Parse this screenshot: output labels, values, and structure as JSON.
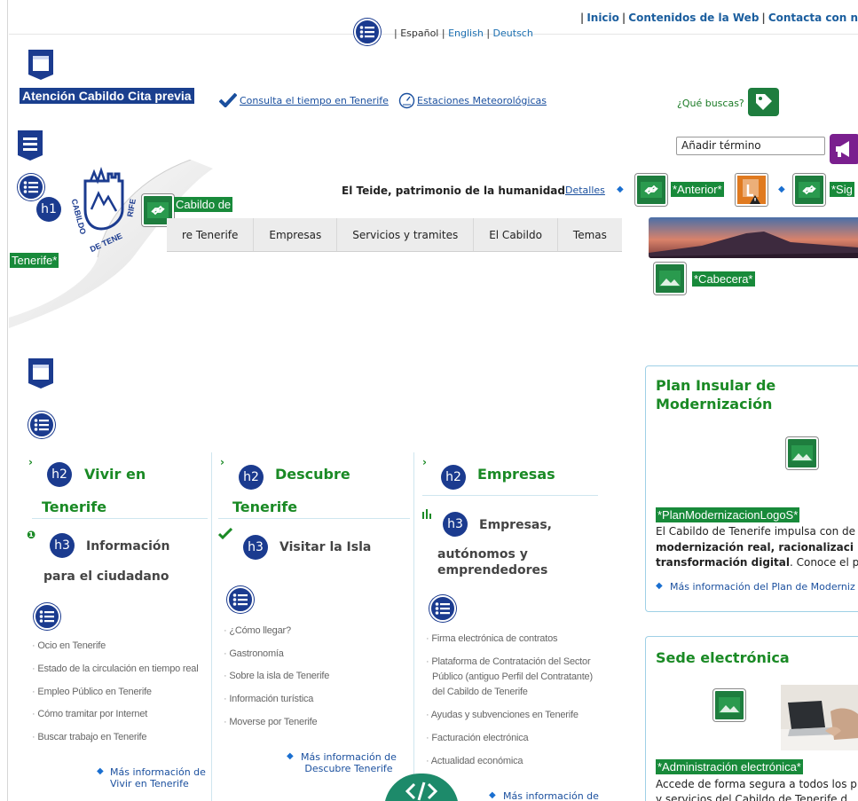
{
  "header": {
    "lang_current": "| Español",
    "lang_sep1": "|",
    "lang_en": "English",
    "lang_sep2": "|",
    "lang_de": "Deutsch",
    "top_inicio": "Inicio",
    "top_contenidos": "Contenidos de la Web",
    "top_contacta": "Contacta con n",
    "cita_button": "Atención Cabildo Cita previa",
    "weather_link": "Consulta el tiempo en Tenerife",
    "stations_link": "Estaciones Meteorológicas",
    "search_label": "¿Qué buscas?",
    "search_value": "Añadir término",
    "logo_alt_prefix": "Cabildo de",
    "logo_alt_suffix": "Tenerife*",
    "logo_text": "CABILDO DE TENERIFE"
  },
  "carousel": {
    "caption": "El Teide, patrimonio de la humanidad",
    "details_link": "Detalles",
    "prev_label": "*Anterior*",
    "next_label": "*Sig",
    "header_image_label": "*Cabecera*"
  },
  "nav": {
    "items": [
      "re Tenerife",
      "Empresas",
      "Servicios y tramites",
      "El Cabildo",
      "Temas"
    ]
  },
  "columns": {
    "vivir": {
      "h2_line1": "Vivir en",
      "h2_line2": "Tenerife",
      "h3_line1": "Información",
      "h3_line2": "para el ciudadano",
      "items": [
        "Ocio en Tenerife",
        "Estado de la circulación en tiempo real",
        "Empleo Público en Tenerife",
        "Cómo tramitar por Internet",
        "Buscar trabajo en Tenerife"
      ],
      "more_line1": "Más información de",
      "more_line2": "Vivir en Tenerife"
    },
    "descubre": {
      "h2_line1": "Descubre",
      "h2_line2": "Tenerife",
      "h3": "Visitar la Isla",
      "items": [
        "¿Cómo llegar?",
        "Gastronomía",
        "Sobre la isla de Tenerife",
        "Información turística",
        "Moverse por Tenerife"
      ],
      "more_line1": "Más información de",
      "more_line2": "Descubre Tenerife"
    },
    "empresas": {
      "h2": "Empresas",
      "h3_line1": "Empresas,",
      "h3_line2": "autónomos y",
      "h3_line3": "emprendedores",
      "items": [
        "Firma electrónica de contratos",
        "Plataforma de Contratación del Sector",
        "Público (antiguo Perfil del Contratante)",
        "del Cabildo de Tenerife",
        "Ayudas y subvenciones en Tenerife",
        "Facturación electrónica",
        "Actualidad económica"
      ],
      "more_line1": "Más información de"
    }
  },
  "sidebar": {
    "plan": {
      "title_line1": "Plan Insular de",
      "title_line2": "Modernización",
      "image_label": "*PlanModernizacionLogoS*",
      "text1": "El Cabildo de Tenerife impulsa con de",
      "text2": "modernización real, racionalizaci",
      "text3_bold": "transformación digital",
      "text3_rest": ". Conoce el p",
      "more": "Más información del Plan de Moderniz"
    },
    "sede": {
      "title": "Sede electrónica",
      "image_label": "*Administración electrónica*",
      "text1": "Accede de forma segura a todos los p",
      "text2": "y servicios del Cabildo de Tenerife d"
    }
  },
  "colors": {
    "brand_blue": "#1a3f8e",
    "green": "#1a8a25",
    "wave_green": "#188a3a",
    "link_blue": "#1a4f9e"
  },
  "icons": [
    "list-icon",
    "h1-icon",
    "h2-icon",
    "h3-icon",
    "region-icon",
    "image-icon",
    "link-icon",
    "code-icon",
    "weather-check-icon",
    "gauge-icon",
    "tag-icon",
    "megaphone-icon",
    "arrow-left-icon",
    "arrow-right-icon"
  ]
}
